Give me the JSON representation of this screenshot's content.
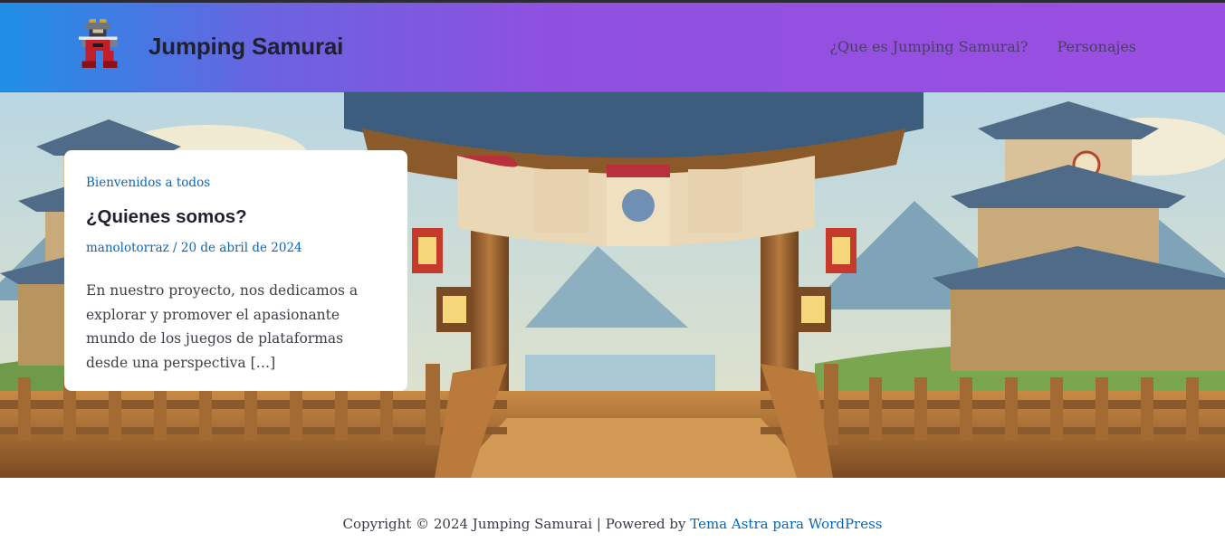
{
  "header": {
    "site_title": "Jumping Samurai",
    "logo_icon": "samurai-pixel-logo-icon",
    "nav": [
      {
        "label": "¿Que es Jumping Samurai?"
      },
      {
        "label": "Personajes"
      }
    ],
    "gradient": [
      "#1f8fe6",
      "#9a4fe2"
    ]
  },
  "hero": {
    "image": "japanese-temple-gate-illustration"
  },
  "post": {
    "category": "Bienvenidos a todos",
    "title": "¿Quienes somos?",
    "author": "manolotorraz",
    "separator": " / ",
    "date": "20 de abril de 2024",
    "excerpt": "En nuestro proyecto, nos dedicamos a explorar y promover el apasionante mundo de los juegos de plataformas desde una perspectiva",
    "more": "[…]"
  },
  "footer": {
    "copyright": "Copyright © 2024 Jumping Samurai | Powered by ",
    "theme_link": "Tema Astra para WordPress"
  },
  "colors": {
    "link": "#0a66b8",
    "title": "#1f2130",
    "text": "#3f3f48"
  }
}
